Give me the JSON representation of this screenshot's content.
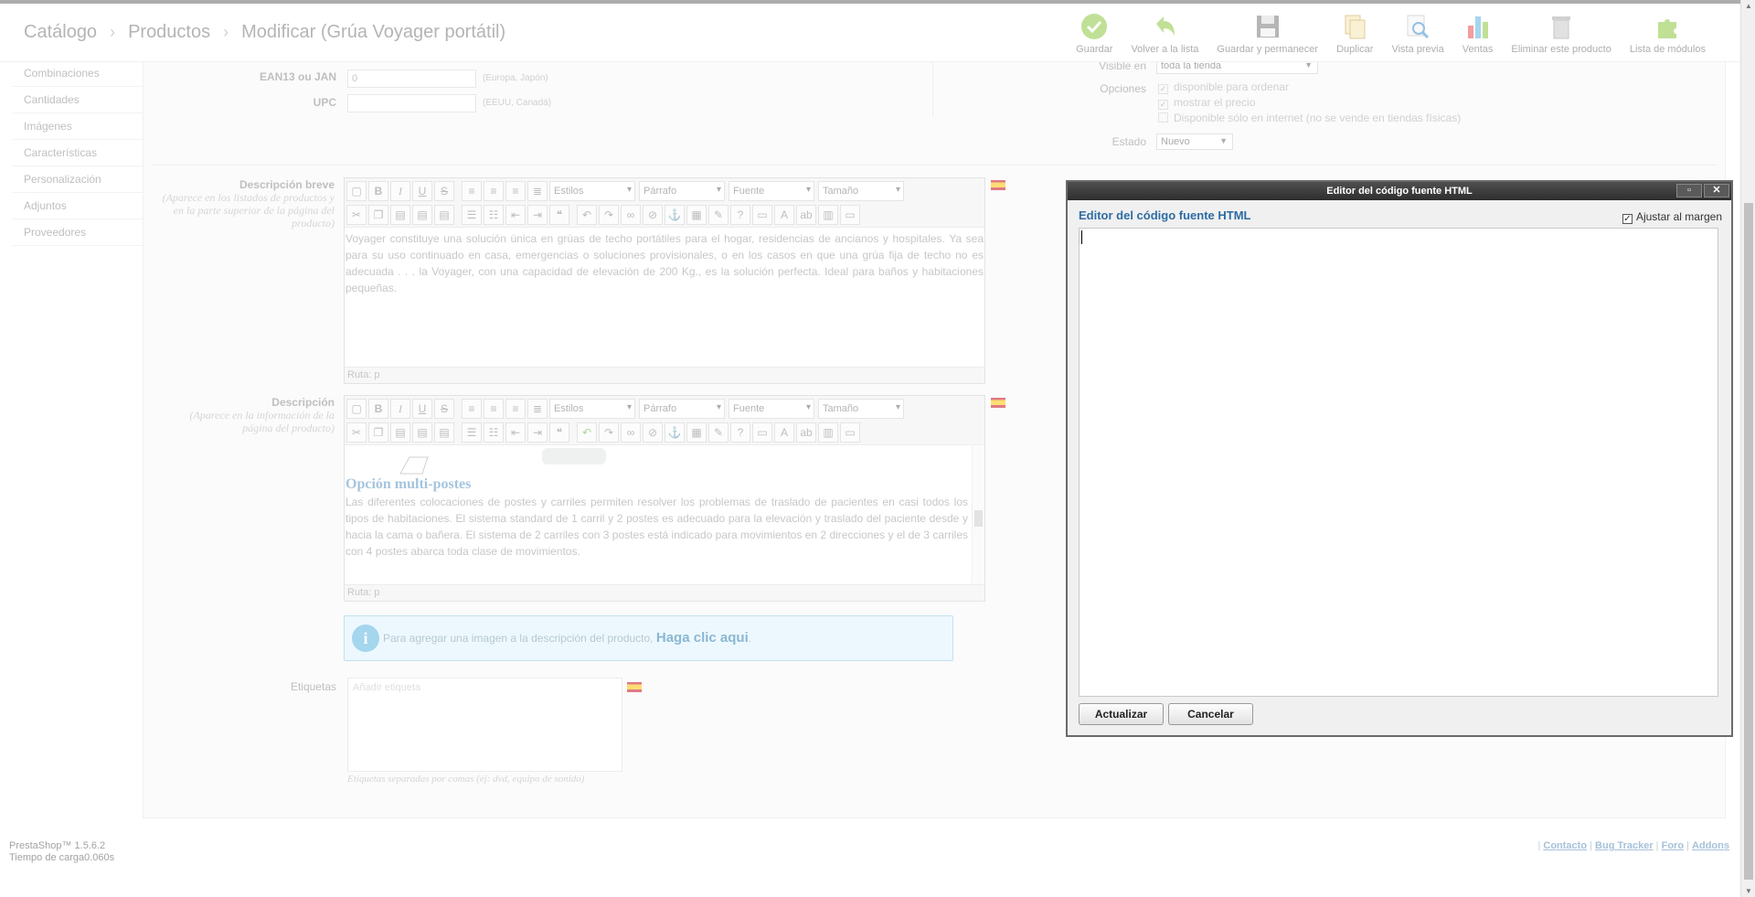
{
  "header": {
    "breadcrumb": [
      "Catálogo",
      "Productos",
      "Modificar (Grúa Voyager portátil)"
    ],
    "toolbar": [
      {
        "label": "Guardar",
        "icon": "check-icon"
      },
      {
        "label": "Volver a la lista",
        "icon": "back-arrow-icon"
      },
      {
        "label": "Guardar y permanecer",
        "icon": "floppy-icon"
      },
      {
        "label": "Duplicar",
        "icon": "duplicate-icon"
      },
      {
        "label": "Vista previa",
        "icon": "preview-icon"
      },
      {
        "label": "Ventas",
        "icon": "bar-chart-icon"
      },
      {
        "label": "Eliminar este producto",
        "icon": "trash-icon"
      },
      {
        "label": "Lista de módulos",
        "icon": "puzzle-icon"
      }
    ]
  },
  "sidebar": {
    "items": [
      "Combinaciones",
      "Cantidades",
      "Imágenes",
      "Características",
      "Personalización",
      "Adjuntos",
      "Proveedores"
    ]
  },
  "form": {
    "ean_label": "EAN13 ou JAN",
    "ean_value": "0",
    "ean_hint": "(Europa, Japón)",
    "upc_label": "UPC",
    "upc_value": "",
    "upc_hint": "(EEUU, Canadá)",
    "visible_label": "Visible en",
    "visible_value": "toda la tienda",
    "options_label": "Opciones",
    "options": [
      {
        "label": "disponible para ordenar",
        "checked": true
      },
      {
        "label": "mostrar el precio",
        "checked": true
      },
      {
        "label": "Disponible sólo en internet (no se vende en tiendas físicas)",
        "checked": false
      }
    ],
    "condition_label": "Estado",
    "condition_value": "Nuevo",
    "short_desc_label": "Descripción breve",
    "short_desc_hint": "(Aparece en los listados de productos y en la parte superior de la página del producto)",
    "short_desc_text": "Voyager constituye una solución única en grúas de techo portátiles para el hogar, residencias de ancianos y hospitales. Ya sea para su uso continuado en casa, emergencias o soluciones provisionales, o en los casos en que una grúa fija de techo no es adecuada . . . la Voyager, con una capacidad de elevación de 200 Kg., es la solución perfecta. Ideal para baños y habitaciones pequeñas.",
    "desc_label": "Descripción",
    "desc_hint": "(Aparece en la información de la página del producto)",
    "desc_heading": "Opción multi-postes",
    "desc_text": "Las diferentes colocaciones de postes y carriles permiten resolver los problemas de traslado de pacientes en casi todos los tipos de habitaciones. El sistema standard de 1 carril y 2 postes es adecuado para la elevación y traslado del paciente desde y hacia la cama o bañera. El sistema de 2 carriles con 3 postes está indicado para movimientos en 2 direcciones y el de 3 carriles con 4 postes abarca toda clase de movimientos.",
    "editor_path": "Ruta: p",
    "editor_dropdowns": [
      "Estilos",
      "Párrafo",
      "Fuente",
      "Tamaño"
    ],
    "image_info_text": "Para agregar una imagen a la descripción del producto,",
    "image_info_link": "Haga clic aqui",
    "image_info_end": ".",
    "tags_label": "Etiquetas",
    "tags_placeholder": "Añadir etiqueta",
    "tags_hint": "Etiquetas separadas por comas (ej: dvd, equipo de sonido)"
  },
  "modal": {
    "title": "Editor del código fuente HTML",
    "heading": "Editor del código fuente HTML",
    "wrap_label": "Ajustar al margen",
    "wrap_checked": true,
    "update_button": "Actualizar",
    "cancel_button": "Cancelar"
  },
  "footer": {
    "version": "PrestaShop™ 1.5.6.2",
    "load_time": "Tiempo de carga0.060s",
    "links": [
      "Contacto",
      "Bug Tracker",
      "Foro",
      "Addons"
    ]
  },
  "colors": {
    "modal_title": "#3a3a3a",
    "link": "#2a7dae",
    "info_bg": "#dff3fd",
    "heading_blue": "#2e6ca3"
  }
}
